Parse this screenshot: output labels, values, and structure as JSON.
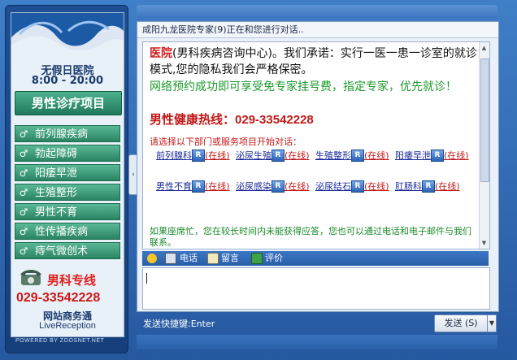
{
  "sidebar": {
    "hours_title": "无假日医院",
    "hours_time": "8:00 - 20:00",
    "section_title": "男性诊疗项目",
    "services": [
      "前列腺疾病",
      "勃起障碍",
      "阳痿早泄",
      "生殖整形",
      "男性不育",
      "性传播疾病",
      "痔气微创术"
    ],
    "service_mark": "♂",
    "phone_label": "男科专线",
    "phone_number": "029-33542228",
    "brand_line1": "网站商务通",
    "brand_line2": "LiveReception",
    "powered": "POWERED BY ZOOSNET.NET"
  },
  "chat": {
    "header": "咸阳九龙医院专家(9)正在和您进行对话..",
    "intro_hospital": "医院",
    "intro_rest": "(男科疾病咨询中心)。我们承诺：实行一医一患一诊室的就诊模式,您的隐私我们会严格保密。",
    "intro_green": "网络预约成功即可享受免专家挂号费，指定专家，优先就诊！",
    "hotline_label": "男性健康热线：",
    "hotline_number": "029-33542228",
    "choose_text": "请选择以下部门或服务项目开始对话：",
    "departments": [
      {
        "name": "前列腺科",
        "status": "(在线)"
      },
      {
        "name": "泌尿生殖",
        "status": "(在线)"
      },
      {
        "name": "生殖整形",
        "status": "(在线)"
      },
      {
        "name": "阳痿早泄",
        "status": "(在线)"
      },
      {
        "name": "男性不育",
        "status": "(在线)"
      },
      {
        "name": "泌尿感染",
        "status": "(在线)"
      },
      {
        "name": "泌尿结石",
        "status": "(在线)"
      },
      {
        "name": "肛肠科",
        "status": "(在线)"
      }
    ],
    "dept_icon_letter": "R",
    "notice": "如果座席忙，您在较长时间内未能获得应答，您也可以通过电话和电子邮件与我们联系。"
  },
  "toolbar": {
    "phone_label": "电话",
    "message_label": "留言",
    "rate_label": "评价"
  },
  "footer": {
    "shortcut": "发送快捷键:Enter",
    "send_label": "发送 (S)",
    "dropdown": "▼"
  },
  "colors": {
    "accent": "#2d63a8",
    "service_green": "#2a8463",
    "hospital_red": "#d01c1c",
    "notice_green": "#1c8a2a"
  }
}
